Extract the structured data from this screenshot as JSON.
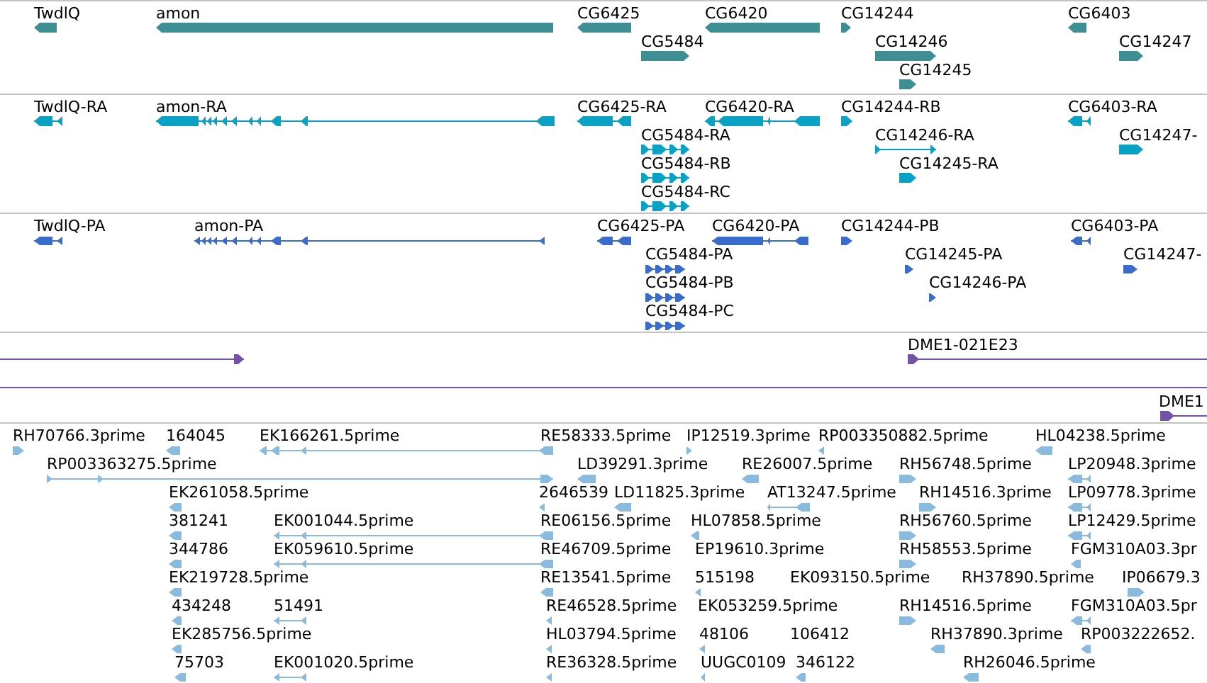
{
  "tracks": [
    {
      "kind": "gene",
      "color": "#3d8f93",
      "features": [
        {
          "label": "TwdlQ",
          "reverse_strand": true
        },
        {
          "label": "amon",
          "reverse_strand": true
        },
        {
          "label": "CG6425",
          "reverse_strand": true
        },
        {
          "label": "CG6420",
          "reverse_strand": true
        },
        {
          "label": "CG14244",
          "reverse_strand": false
        },
        {
          "label": "CG6403",
          "reverse_strand": true
        },
        {
          "label": "CG5484",
          "reverse_strand": false
        },
        {
          "label": "CG14246",
          "reverse_strand": false
        },
        {
          "label": "CG14247",
          "reverse_strand": false
        },
        {
          "label": "CG14245",
          "reverse_strand": false
        }
      ]
    },
    {
      "kind": "transcript",
      "color": "#0aa2c4",
      "features": [
        {
          "label": "TwdlQ-RA",
          "reverse_strand": true
        },
        {
          "label": "amon-RA",
          "reverse_strand": true
        },
        {
          "label": "CG6425-RA",
          "reverse_strand": true
        },
        {
          "label": "CG6420-RA",
          "reverse_strand": true
        },
        {
          "label": "CG14244-RB",
          "reverse_strand": false
        },
        {
          "label": "CG6403-RA",
          "reverse_strand": true
        },
        {
          "label": "CG5484-RA",
          "reverse_strand": false
        },
        {
          "label": "CG14246-RA",
          "reverse_strand": false
        },
        {
          "label": "CG14247-",
          "reverse_strand": false
        },
        {
          "label": "CG5484-RB",
          "reverse_strand": false
        },
        {
          "label": "CG14245-RA",
          "reverse_strand": false
        },
        {
          "label": "CG5484-RC",
          "reverse_strand": false
        }
      ]
    },
    {
      "kind": "protein",
      "color": "#3a6ccc",
      "features": [
        {
          "label": "TwdlQ-PA",
          "reverse_strand": true
        },
        {
          "label": "amon-PA",
          "reverse_strand": true
        },
        {
          "label": "CG6425-PA",
          "reverse_strand": true
        },
        {
          "label": "CG6420-PA",
          "reverse_strand": true
        },
        {
          "label": "CG14244-PB",
          "reverse_strand": false
        },
        {
          "label": "CG6403-PA",
          "reverse_strand": true
        },
        {
          "label": "CG5484-PA",
          "reverse_strand": false
        },
        {
          "label": "CG14245-PA",
          "reverse_strand": false
        },
        {
          "label": "CG14247-",
          "reverse_strand": false
        },
        {
          "label": "CG5484-PB",
          "reverse_strand": false
        },
        {
          "label": "CG14246-PA",
          "reverse_strand": false
        },
        {
          "label": "CG5484-PC",
          "reverse_strand": false
        }
      ]
    },
    {
      "kind": "clone",
      "color": "#7452a8",
      "features": [
        {
          "kind": "arrow",
          "reverse_strand": false
        },
        {
          "kind": "arrow",
          "label": "DME1-021E23",
          "reverse_strand": false
        },
        {
          "kind": "connector"
        },
        {
          "kind": "arrow",
          "label": "DME1",
          "reverse_strand": false
        }
      ]
    },
    {
      "kind": "est",
      "color": "#88bbdd",
      "features": [
        {
          "label": "RH70766.3prime",
          "reverse_strand": false
        },
        {
          "label": "164045",
          "reverse_strand": true
        },
        {
          "label": "EK166261.5prime",
          "reverse_strand": true
        },
        {
          "label": "RE58333.5prime"
        },
        {
          "label": "IP12519.3prime",
          "reverse_strand": false
        },
        {
          "label": "RP003350882.5prime",
          "reverse_strand": true
        },
        {
          "label": "HL04238.5prime",
          "reverse_strand": true
        },
        {
          "label": "RP003363275.5prime",
          "reverse_strand": false
        },
        {
          "label": "LD39291.3prime",
          "reverse_strand": true
        },
        {
          "label": "RE26007.5prime",
          "reverse_strand": true
        },
        {
          "label": "RH56748.5prime",
          "reverse_strand": false
        },
        {
          "label": "LP20948.3prime",
          "reverse_strand": true
        },
        {
          "label": "EK261058.5prime",
          "reverse_strand": true
        },
        {
          "label": "2646539",
          "reverse_strand": true
        },
        {
          "label": "LD11825.3prime",
          "reverse_strand": true
        },
        {
          "label": "AT13247.5prime",
          "reverse_strand": true
        },
        {
          "label": "RH14516.3prime",
          "reverse_strand": false
        },
        {
          "label": "LP09778.3prime",
          "reverse_strand": true
        },
        {
          "label": "381241",
          "reverse_strand": true
        },
        {
          "label": "EK001044.5prime",
          "reverse_strand": true
        },
        {
          "label": "RE06156.5prime"
        },
        {
          "label": "HL07858.5prime",
          "reverse_strand": true
        },
        {
          "label": "RH56760.5prime",
          "reverse_strand": false
        },
        {
          "label": "LP12429.5prime",
          "reverse_strand": true
        },
        {
          "label": "344786",
          "reverse_strand": true
        },
        {
          "label": "EK059610.5prime",
          "reverse_strand": true
        },
        {
          "label": "RE46709.5prime"
        },
        {
          "label": "EP19610.3prime"
        },
        {
          "label": "RH58553.5prime",
          "reverse_strand": false
        },
        {
          "label": "FGM310A03.3pr",
          "reverse_strand": true
        },
        {
          "label": "EK219728.5prime",
          "reverse_strand": true
        },
        {
          "label": "RE13541.5prime",
          "reverse_strand": true
        },
        {
          "label": "515198",
          "reverse_strand": true
        },
        {
          "label": "EK093150.5prime"
        },
        {
          "label": "RH37890.5prime"
        },
        {
          "label": "IP06679.3",
          "reverse_strand": false
        },
        {
          "label": "434248",
          "reverse_strand": true
        },
        {
          "label": "51491",
          "reverse_strand": true
        },
        {
          "label": "RE46528.5prime",
          "reverse_strand": true
        },
        {
          "label": "EK053259.5prime"
        },
        {
          "label": "RH14516.5prime",
          "reverse_strand": false
        },
        {
          "label": "FGM310A03.5pr",
          "reverse_strand": true
        },
        {
          "label": "EK285756.5prime",
          "reverse_strand": true
        },
        {
          "label": "HL03794.5prime",
          "reverse_strand": true
        },
        {
          "label": "48106",
          "reverse_strand": true
        },
        {
          "label": "106412"
        },
        {
          "label": "RH37890.3prime",
          "reverse_strand": true
        },
        {
          "label": "RP003222652.",
          "reverse_strand": true
        },
        {
          "label": "75703",
          "reverse_strand": true
        },
        {
          "label": "EK001020.5prime",
          "reverse_strand": true
        },
        {
          "label": "RE36328.5prime",
          "reverse_strand": true
        },
        {
          "label": "UUGC0109",
          "reverse_strand": true
        },
        {
          "label": "346122",
          "reverse_strand": true
        },
        {
          "label": "RH26046.5prime",
          "reverse_strand": true
        }
      ]
    }
  ]
}
